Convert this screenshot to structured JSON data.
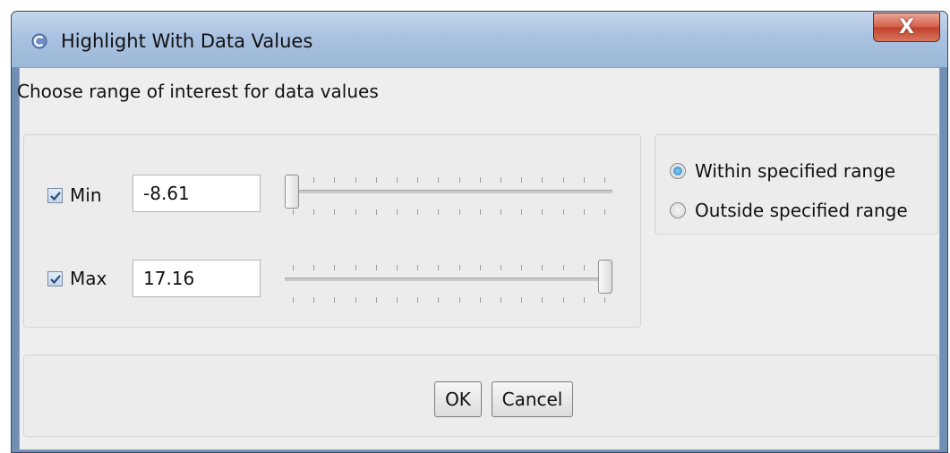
{
  "window": {
    "title": "Highlight With Data Values",
    "close_glyph": "X",
    "icon": "app-icon"
  },
  "heading": "Choose range of interest for data values",
  "range": {
    "min": {
      "label": "Min",
      "checked": true,
      "value": "-8.61",
      "slider_fraction": 0.0
    },
    "max": {
      "label": "Max",
      "checked": true,
      "value": "17.16",
      "slider_fraction": 1.0
    }
  },
  "mode": {
    "options": [
      {
        "label": "Within specified range",
        "selected": true
      },
      {
        "label": "Outside specified range",
        "selected": false
      }
    ]
  },
  "buttons": {
    "ok": "OK",
    "cancel": "Cancel"
  },
  "colors": {
    "titlebar": "#a9c2e1",
    "close": "#c0412c",
    "radio_selected": "#1d7bc4"
  }
}
